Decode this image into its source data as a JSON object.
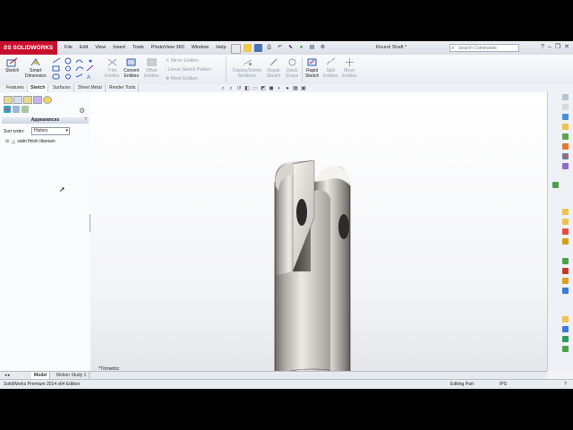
{
  "app": {
    "logo_text": "SOLIDWORKS",
    "document_title": "Round Shaft *",
    "menu": [
      "File",
      "Edit",
      "View",
      "Insert",
      "Tools",
      "PhotoView 360",
      "Window",
      "Help"
    ],
    "search_placeholder": "Search Commands"
  },
  "commands": {
    "sketch": "Sketch",
    "smart_dimension_1": "Smart",
    "smart_dimension_2": "Dimension",
    "trim_1": "Trim",
    "trim_2": "Entities",
    "convert_1": "Convert",
    "convert_2": "Entities",
    "offset_1": "Offset",
    "offset_2": "Entities",
    "mirror": "Mirror Entities",
    "linear_pattern": "Linear Sketch Pattern",
    "move": "Move Entities",
    "display_delete_1": "Display/Delete",
    "display_delete_2": "Relations",
    "repair_1": "Repair",
    "repair_2": "Sketch",
    "quick_snaps_1": "Quick",
    "quick_snaps_2": "Snaps",
    "rapid_1": "Rapid",
    "rapid_2": "Sketch",
    "split_1": "Split",
    "split_2": "Entities",
    "move2_1": "Move",
    "move2_2": "Entities"
  },
  "tabs": [
    "Features",
    "Sketch",
    "Surfaces",
    "Sheet Metal",
    "Render Tools"
  ],
  "active_tab": "Sketch",
  "panel": {
    "header": "Appearances",
    "help": "?",
    "sort_label": "Sort order:",
    "sort_value": "History",
    "items": [
      "satin finish titanium"
    ]
  },
  "viewport": {
    "view_label": "*Trimetric"
  },
  "bottom_tabs": [
    "Model",
    "Motion Study 1"
  ],
  "status": {
    "edition": "SolidWorks Premium 2014 x64 Edition",
    "mode": "Editing Part",
    "units": "IPS",
    "help": "?"
  },
  "colors": {
    "brand": "#c8102e",
    "part_metal": "#b9b6b2",
    "viewport_bg": "#ffffff"
  }
}
